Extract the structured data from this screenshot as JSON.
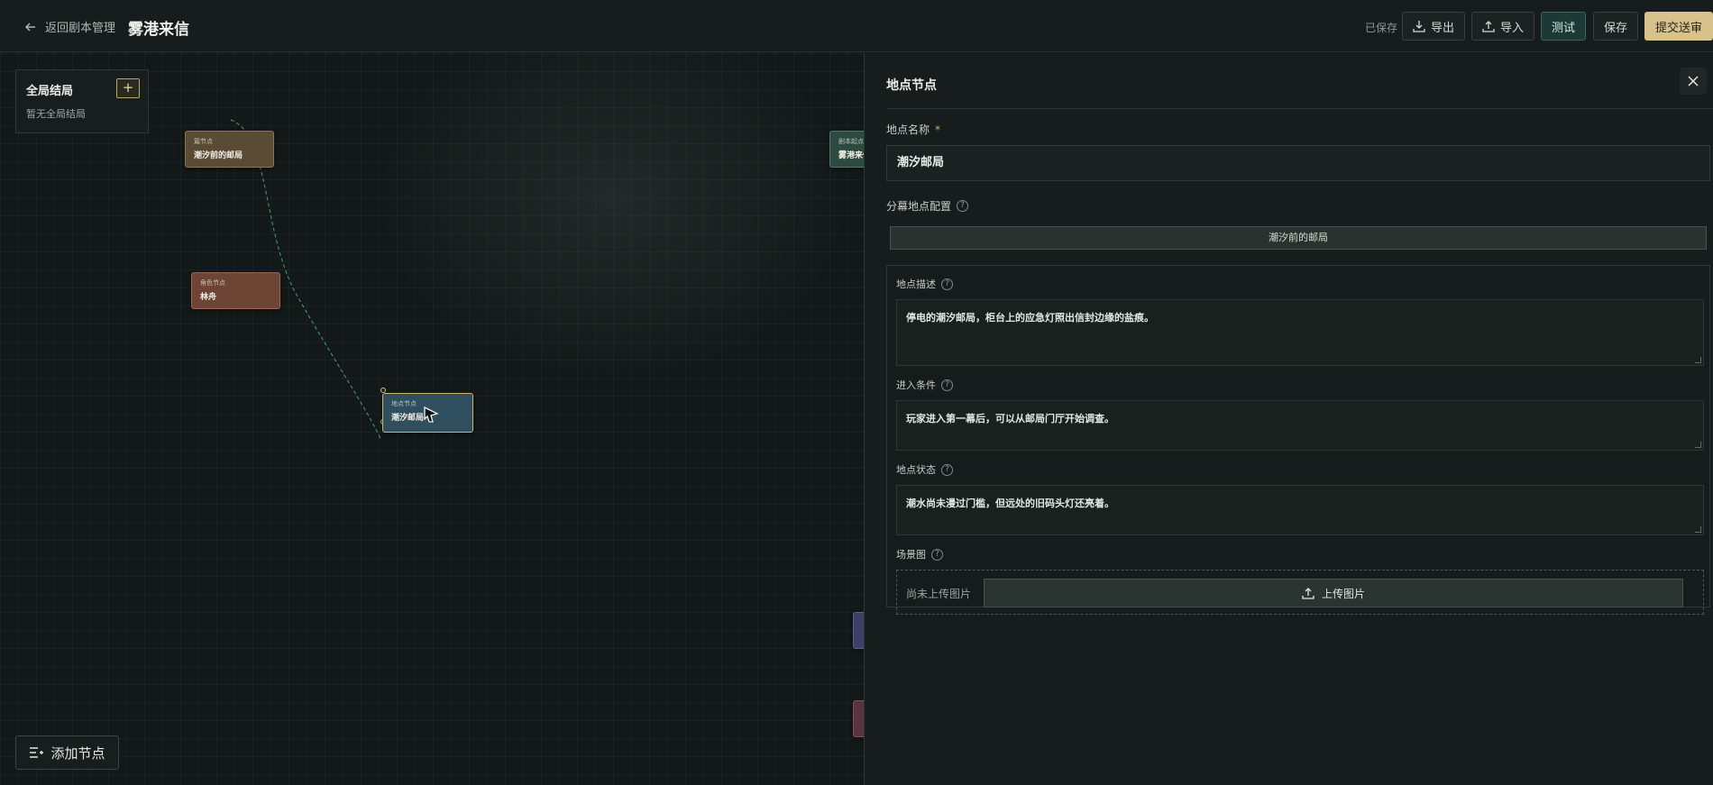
{
  "header": {
    "back_label": "返回剧本管理",
    "title": "雾港来信",
    "saved_status": "已保存",
    "export_label": "导出",
    "import_label": "导入",
    "test_label": "测试",
    "save_label": "保存",
    "submit_label": "提交送审"
  },
  "canvas": {
    "global_endings": {
      "title": "全局结局",
      "add_label": "+",
      "empty_text": "暂无全局结局"
    },
    "nodes": {
      "ending": {
        "type": "篇节点",
        "name": "潮汐前的邮局"
      },
      "role": {
        "type": "角色节点",
        "name": "林舟"
      },
      "location": {
        "type": "地点节点",
        "name": "潮汐邮局"
      },
      "start": {
        "type": "剧本起点",
        "name": "雾港来信"
      }
    },
    "add_node_label": "添加节点"
  },
  "panel": {
    "title": "地点节点",
    "name_label": "地点名称",
    "name_required": "*",
    "name_value": "潮汐邮局",
    "act_config_label": "分幕地点配置",
    "act_tab": "潮汐前的邮局",
    "description_label": "地点描述",
    "description_value": "停电的潮汐邮局，柜台上的应急灯照出信封边缘的盐痕。",
    "entry_label": "进入条件",
    "entry_value": "玩家进入第一幕后，可以从邮局门厅开始调查。",
    "state_label": "地点状态",
    "state_value": "潮水尚未漫过门槛，但远处的旧码头灯还亮着。",
    "scene_label": "场景图",
    "scene_empty": "尚未上传图片",
    "upload_label": "上传图片"
  },
  "colors": {
    "accent_gold": "#d8c28c",
    "test_teal": "#1d3835",
    "location_node": "#2f4e5e",
    "role_node": "#6e4434",
    "ending_node": "#5a4c34"
  }
}
